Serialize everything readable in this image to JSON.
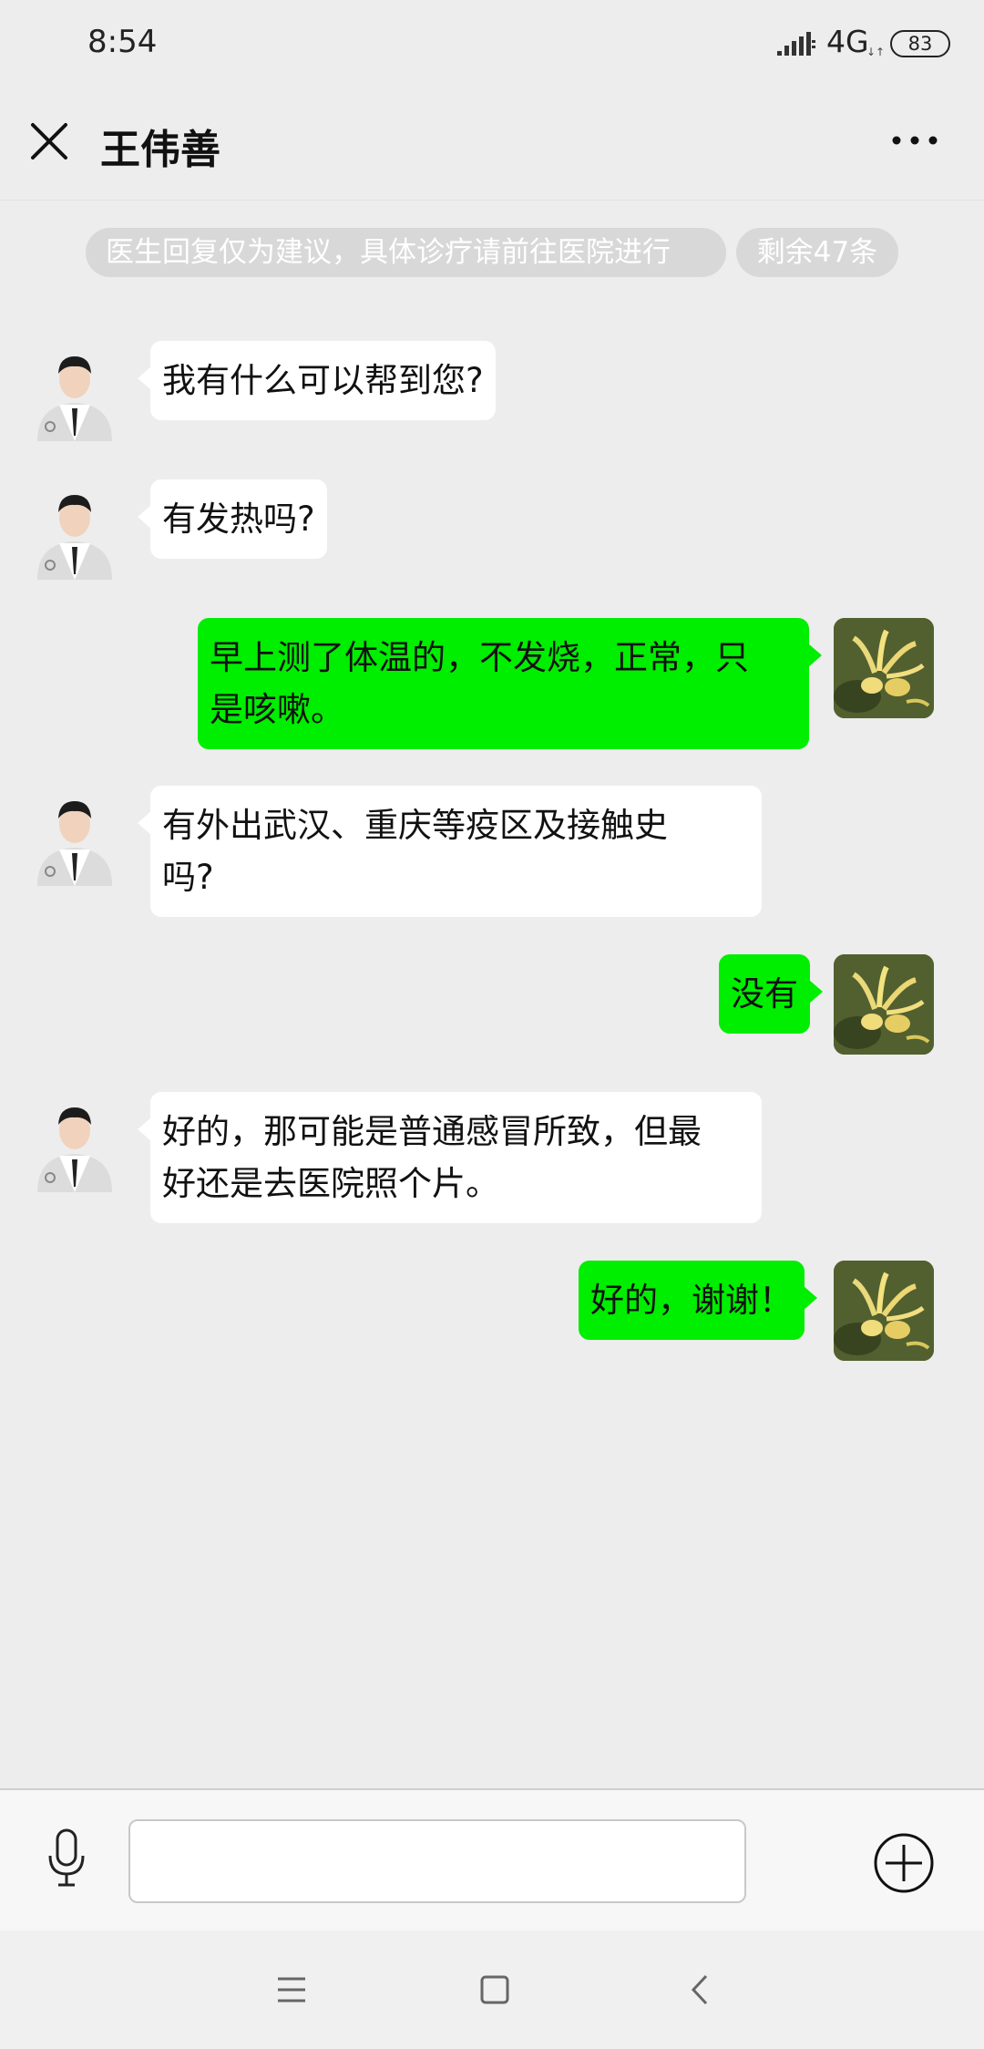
{
  "status_bar": {
    "time": "8:54",
    "network": "4G",
    "network_sub": "↓↑",
    "battery": "83",
    "icons": [
      "signal-icon",
      "battery-icon"
    ]
  },
  "header": {
    "title": "王伟善",
    "icons": [
      "close-icon",
      "more-icon"
    ]
  },
  "notice": {
    "text": "医生回复仅为建议，具体诊疗请前往医院进行",
    "remaining": "剩余47条"
  },
  "messages": [
    {
      "sender": "doctor",
      "lines": [
        "我有什么可以帮到您?"
      ]
    },
    {
      "sender": "doctor",
      "lines": [
        "有发热吗?"
      ]
    },
    {
      "sender": "user",
      "lines": [
        "早上测了体温的，不发烧，正常，只",
        "是咳嗽。"
      ]
    },
    {
      "sender": "doctor",
      "lines": [
        "有外出武汉、重庆等疫区及接触史",
        "吗?"
      ]
    },
    {
      "sender": "user",
      "lines": [
        "没有"
      ]
    },
    {
      "sender": "doctor",
      "lines": [
        "好的，那可能是普通感冒所致，但最",
        "好还是去医院照个片。"
      ]
    },
    {
      "sender": "user",
      "lines": [
        "好的，谢谢！"
      ]
    }
  ],
  "input_bar": {
    "value": "",
    "icons": [
      "microphone-icon",
      "plus-circle-icon"
    ]
  },
  "system_nav": {
    "icons": [
      "menu-icon",
      "home-icon",
      "back-icon"
    ]
  },
  "colors": {
    "background": "#ededed",
    "user_bubble": "#00ee00",
    "doctor_bubble": "#ffffff",
    "notice_bg": "#d8d8d8"
  }
}
